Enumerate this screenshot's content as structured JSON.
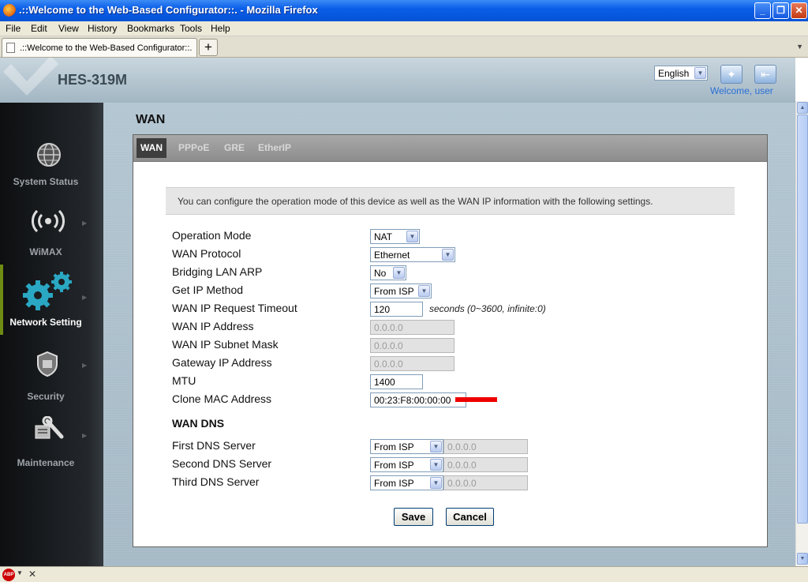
{
  "window": {
    "title": ".::Welcome to the Web-Based Configurator::. - Mozilla Firefox"
  },
  "menu": {
    "items": [
      "File",
      "Edit",
      "View",
      "History",
      "Bookmarks",
      "Tools",
      "Help"
    ]
  },
  "tab": {
    "title": ".::Welcome to the Web-Based Configurator::."
  },
  "header": {
    "product": "HES-319M",
    "language": "English",
    "welcome": "Welcome, user"
  },
  "sidebar": {
    "items": [
      {
        "label": "System Status",
        "icon": "globe-icon"
      },
      {
        "label": "WiMAX",
        "icon": "wireless-icon"
      },
      {
        "label": "Network Setting",
        "icon": "gears-icon",
        "active": true
      },
      {
        "label": "Security",
        "icon": "shield-icon"
      },
      {
        "label": "Maintenance",
        "icon": "tools-icon"
      }
    ]
  },
  "page": {
    "title": "WAN"
  },
  "subtabs": [
    {
      "label": "WAN",
      "active": true
    },
    {
      "label": "PPPoE"
    },
    {
      "label": "GRE"
    },
    {
      "label": "EtherIP"
    }
  ],
  "info": "You can configure the operation mode of this device as well as the WAN IP information with the following settings.",
  "form": {
    "operation_mode": {
      "label": "Operation Mode",
      "value": "NAT"
    },
    "wan_protocol": {
      "label": "WAN Protocol",
      "value": "Ethernet"
    },
    "bridging_lan_arp": {
      "label": "Bridging LAN ARP",
      "value": "No"
    },
    "get_ip_method": {
      "label": "Get IP Method",
      "value": "From ISP"
    },
    "request_timeout": {
      "label": "WAN IP Request Timeout",
      "value": "120",
      "unit": "seconds (0~3600, infinite:0)"
    },
    "wan_ip": {
      "label": "WAN IP Address",
      "value": "0.0.0.0"
    },
    "subnet_mask": {
      "label": "WAN IP Subnet Mask",
      "value": "0.0.0.0"
    },
    "gateway": {
      "label": "Gateway IP Address",
      "value": "0.0.0.0"
    },
    "mtu": {
      "label": "MTU",
      "value": "1400"
    },
    "clone_mac": {
      "label": "Clone MAC Address",
      "value": "00:23:F8:00:00:00"
    }
  },
  "dns": {
    "heading": "WAN DNS",
    "first": {
      "label": "First DNS Server",
      "method": "From ISP",
      "value": "0.0.0.0"
    },
    "second": {
      "label": "Second DNS Server",
      "method": "From ISP",
      "value": "0.0.0.0"
    },
    "third": {
      "label": "Third DNS Server",
      "method": "From ISP",
      "value": "0.0.0.0"
    }
  },
  "buttons": {
    "save": "Save",
    "cancel": "Cancel"
  },
  "colors": {
    "accent": "#6e8c12",
    "redaction": "#ee0000",
    "link": "#2a6fd6"
  }
}
